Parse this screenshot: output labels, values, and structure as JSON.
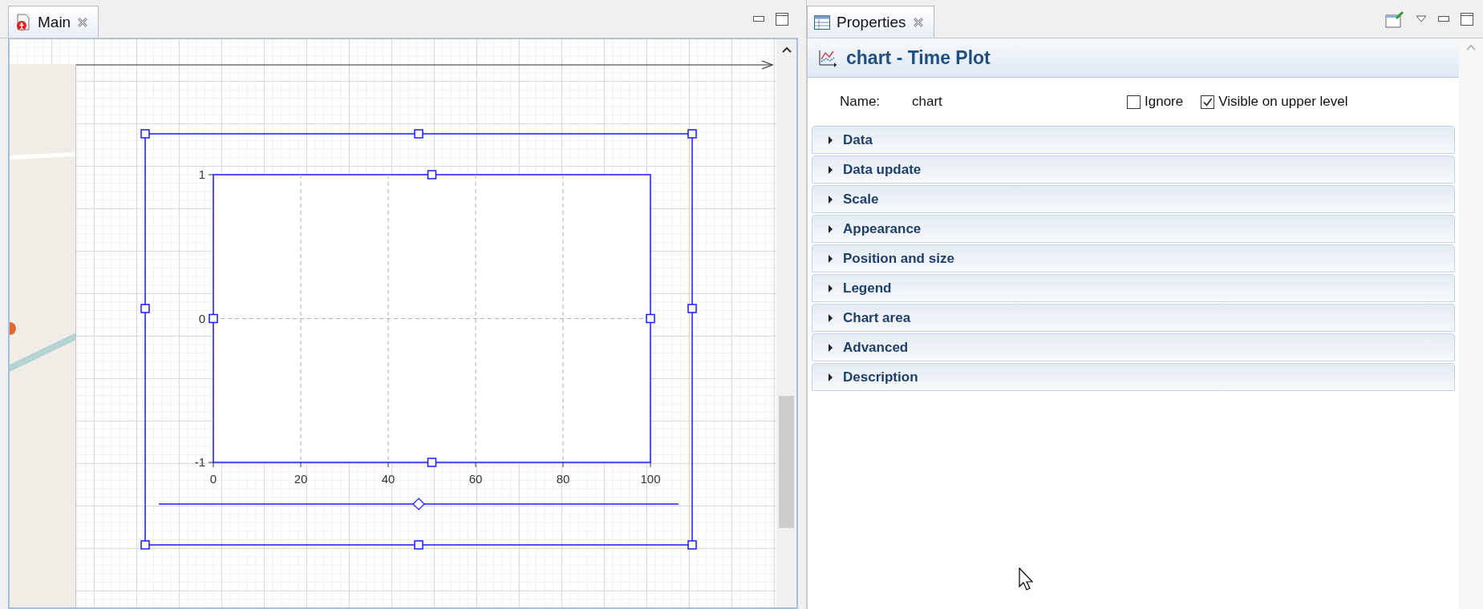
{
  "editor": {
    "tab": {
      "label": "Main",
      "selected": true
    },
    "chart": {
      "chart_data": {
        "type": "line",
        "grid": true,
        "xlim": [
          0,
          100
        ],
        "ylim": [
          -1,
          1
        ],
        "xticks": [
          0,
          20,
          40,
          60,
          80,
          100
        ],
        "yticks": [
          -1,
          0,
          1
        ]
      }
    }
  },
  "properties": {
    "tab": {
      "label": "Properties",
      "selected": true
    },
    "header": "chart - Time Plot",
    "name_label": "Name:",
    "name_value": "chart",
    "checkboxes": [
      {
        "label": "Ignore",
        "checked": false
      },
      {
        "label": "Visible on upper level",
        "checked": true
      }
    ],
    "sections": [
      {
        "label": "Data",
        "expanded": false
      },
      {
        "label": "Data update",
        "expanded": false
      },
      {
        "label": "Scale",
        "expanded": false
      },
      {
        "label": "Appearance",
        "expanded": false
      },
      {
        "label": "Position and size",
        "expanded": false
      },
      {
        "label": "Legend",
        "expanded": false
      },
      {
        "label": "Chart area",
        "expanded": false
      },
      {
        "label": "Advanced",
        "expanded": false
      },
      {
        "label": "Description",
        "expanded": false
      }
    ]
  }
}
